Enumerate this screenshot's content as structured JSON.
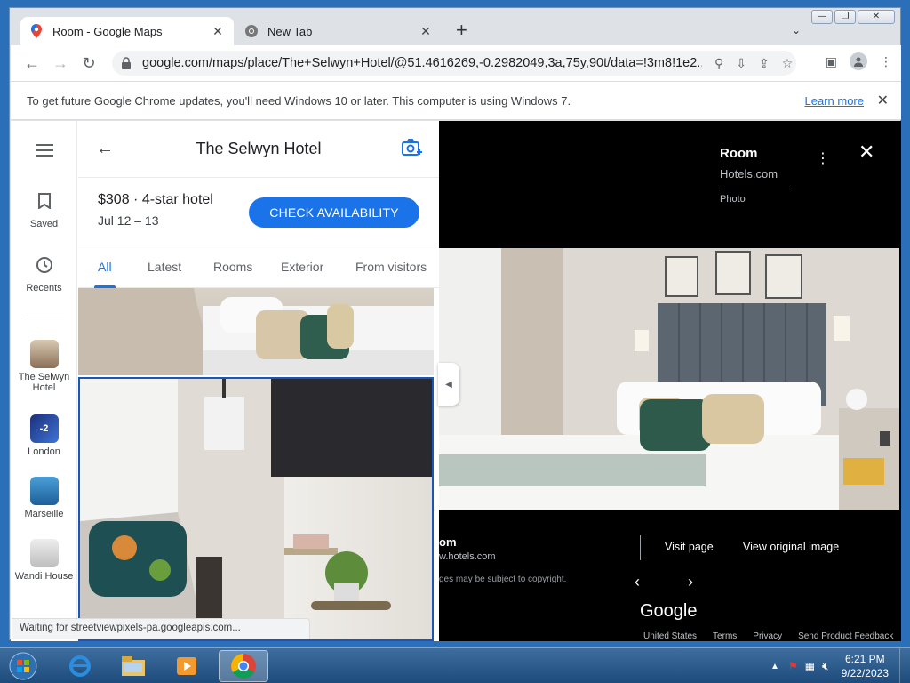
{
  "browser": {
    "tabs": [
      {
        "title": "Room - Google Maps",
        "icon": "maps-pin-icon"
      },
      {
        "title": "New Tab",
        "icon": "chrome-icon"
      }
    ],
    "new_tab": "+",
    "url": "google.com/maps/place/The+Selwyn+Hotel/@51.4616269,-0.2982049,3a,75y,90t/data=!3m8!1e2...",
    "infobar_text": "To get future Google Chrome updates, you'll need Windows 10 or later. This computer is using Windows 7.",
    "infobar_link": "Learn more",
    "status_text": "Waiting for streetviewpixels-pa.googleapis.com..."
  },
  "rail": {
    "saved": "Saved",
    "recents": "Recents",
    "places": [
      {
        "label": "The Selwyn Hotel"
      },
      {
        "label": "London"
      },
      {
        "label": "Marseille"
      },
      {
        "label": "Wandi House"
      }
    ],
    "london_badge": "-2"
  },
  "panel": {
    "title": "The Selwyn Hotel",
    "price": "$308 · 4-star hotel",
    "dates": "Jul 12 – 13",
    "check_button": "CHECK AVAILABILITY",
    "tabs": [
      "All",
      "Latest",
      "Rooms",
      "Exterior",
      "From visitors"
    ],
    "selected_tab": "All"
  },
  "viewer": {
    "title": "Room",
    "source": "Hotels.com",
    "kind": "Photo",
    "footer_source": "om",
    "footer_url": "w.hotels.com",
    "copyright": "ges may be subject to copyright.",
    "visit": "Visit page",
    "original": "View original image",
    "google": "Google",
    "links": [
      "United States",
      "Terms",
      "Privacy",
      "Send Product Feedback"
    ]
  },
  "taskbar": {
    "time": "6:21 PM",
    "date": "9/22/2023"
  },
  "colors": {
    "accent": "#1a73e8",
    "taskbar": "#1d4b7b"
  }
}
